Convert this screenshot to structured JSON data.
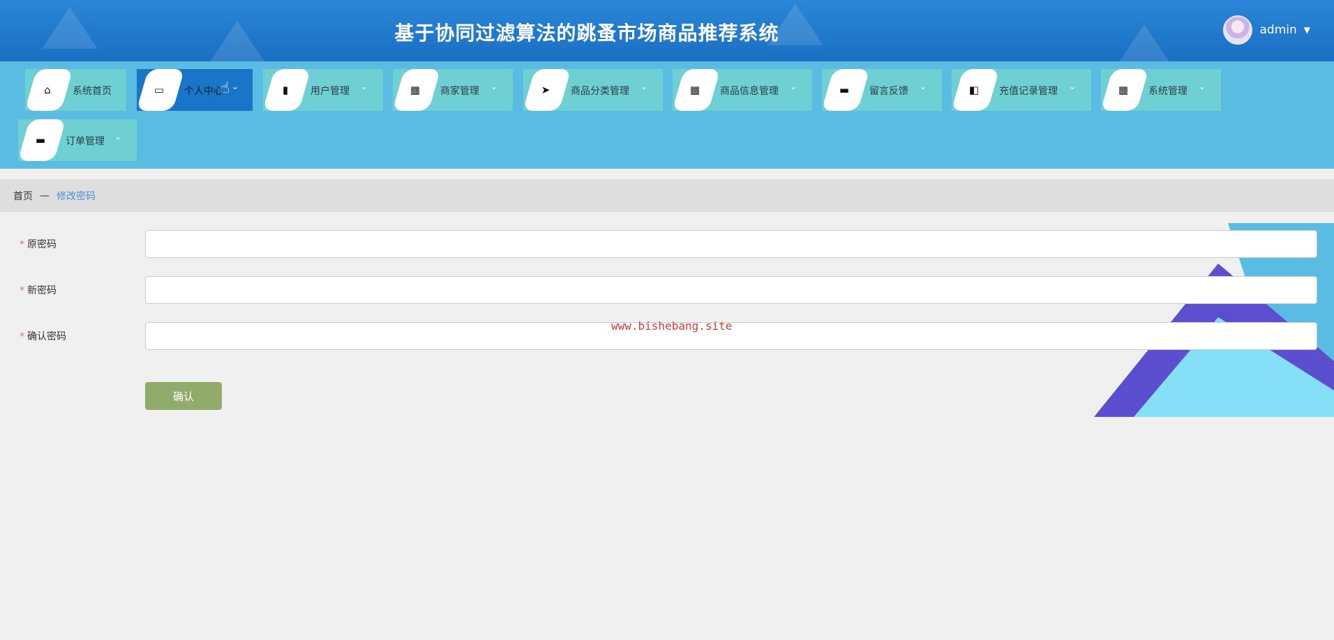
{
  "header": {
    "title": "基于协同过滤算法的跳蚤市场商品推荐系统",
    "user_name": "admin",
    "caret": "▼"
  },
  "nav": {
    "items": [
      {
        "label": "系统首页",
        "icon": "home-icon",
        "glyph": "⌂",
        "has_caret": false,
        "active": false
      },
      {
        "label": "个人中心",
        "icon": "wallet-icon",
        "glyph": "▭",
        "has_caret": true,
        "active": true
      },
      {
        "label": "用户管理",
        "icon": "bar-chart-icon",
        "glyph": "▮",
        "has_caret": true,
        "active": false
      },
      {
        "label": "商家管理",
        "icon": "grid-icon",
        "glyph": "▦",
        "has_caret": true,
        "active": false
      },
      {
        "label": "商品分类管理",
        "icon": "send-icon",
        "glyph": "➤",
        "has_caret": true,
        "active": false
      },
      {
        "label": "商品信息管理",
        "icon": "grid-icon",
        "glyph": "▦",
        "has_caret": true,
        "active": false
      },
      {
        "label": "留言反馈",
        "icon": "briefcase-icon",
        "glyph": "▬",
        "has_caret": true,
        "active": false
      },
      {
        "label": "充值记录管理",
        "icon": "wallet-icon",
        "glyph": "◧",
        "has_caret": true,
        "active": false
      },
      {
        "label": "系统管理",
        "icon": "grid-icon",
        "glyph": "▦",
        "has_caret": true,
        "active": false
      },
      {
        "label": "订单管理",
        "icon": "box-icon",
        "glyph": "▬",
        "has_caret": true,
        "active": false
      }
    ],
    "caret_glyph": "⌄"
  },
  "breadcrumb": {
    "home": "首页",
    "separator": "—",
    "current": "修改密码"
  },
  "form": {
    "required_mark": "*",
    "fields": [
      {
        "label": "原密码",
        "value": "",
        "placeholder": ""
      },
      {
        "label": "新密码",
        "value": "",
        "placeholder": ""
      },
      {
        "label": "确认密码",
        "value": "",
        "placeholder": ""
      }
    ],
    "confirm_label": "确认"
  },
  "watermark": "www.bishebang.site",
  "colors": {
    "header": "#1b6fc4",
    "nav_bg": "#5bbce3",
    "nav_item": "#6fd0d4",
    "nav_active": "#1a74c7",
    "confirm_button": "#91ab6a",
    "breadcrumb_link": "#4a8ed8"
  }
}
